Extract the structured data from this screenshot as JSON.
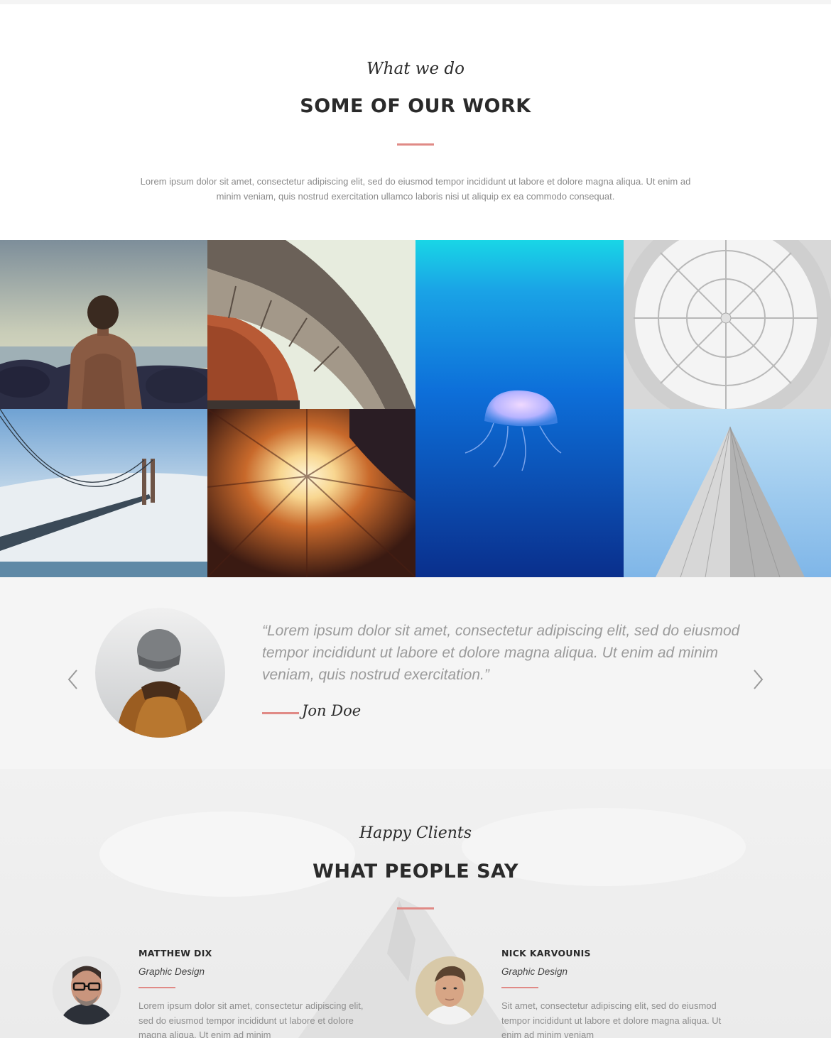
{
  "work": {
    "eyebrow": "What we do",
    "title": "SOME OF OUR WORK",
    "intro": "Lorem ipsum dolor sit amet, consectetur adipiscing elit, sed do eiusmod tempor incididunt ut labore et dolore magna aliqua. Ut enim ad minim veniam, quis nostrud exercitation ullamco laboris nisi ut aliquip ex ea commodo consequat.",
    "gallery": [
      {
        "subject": "man-on-rocks-by-sea"
      },
      {
        "subject": "curved-building-architecture"
      },
      {
        "subject": "jellyfish-underwater"
      },
      {
        "subject": "glass-dome-ceiling"
      },
      {
        "subject": "suspension-bridge-in-fog"
      },
      {
        "subject": "courtyard-buildings-looking-up"
      },
      {
        "subject": "skyscraper-looking-up"
      }
    ]
  },
  "testimonial_slider": {
    "quote": "“Lorem ipsum dolor sit amet, consectetur adipiscing elit, sed do eiusmod tempor incididunt ut labore et dolore magna aliqua. Ut enim ad minim veniam, quis nostrud exercitation.”",
    "author": "Jon Doe",
    "prev_icon": "chevron-left-icon",
    "next_icon": "chevron-right-icon"
  },
  "clients": {
    "eyebrow": "Happy Clients",
    "title": "WHAT PEOPLE SAY",
    "people": [
      {
        "name": "MATTHEW DIX",
        "role": "Graphic Design",
        "text": "Lorem ipsum dolor sit amet, consectetur adipiscing elit, sed do eiusmod tempor incididunt ut labore et dolore magna aliqua. Ut enim ad minim"
      },
      {
        "name": "NICK KARVOUNIS",
        "role": "Graphic Design",
        "text": "Sit amet, consectetur adipiscing elit, sed do eiusmod tempor incididunt ut labore et dolore magna aliqua. Ut enim ad minim veniam"
      }
    ]
  },
  "colors": {
    "accent": "#e08a86",
    "heading": "#2a2a2a",
    "body_text": "#8a8a8a",
    "section_bg": "#f5f5f5"
  }
}
